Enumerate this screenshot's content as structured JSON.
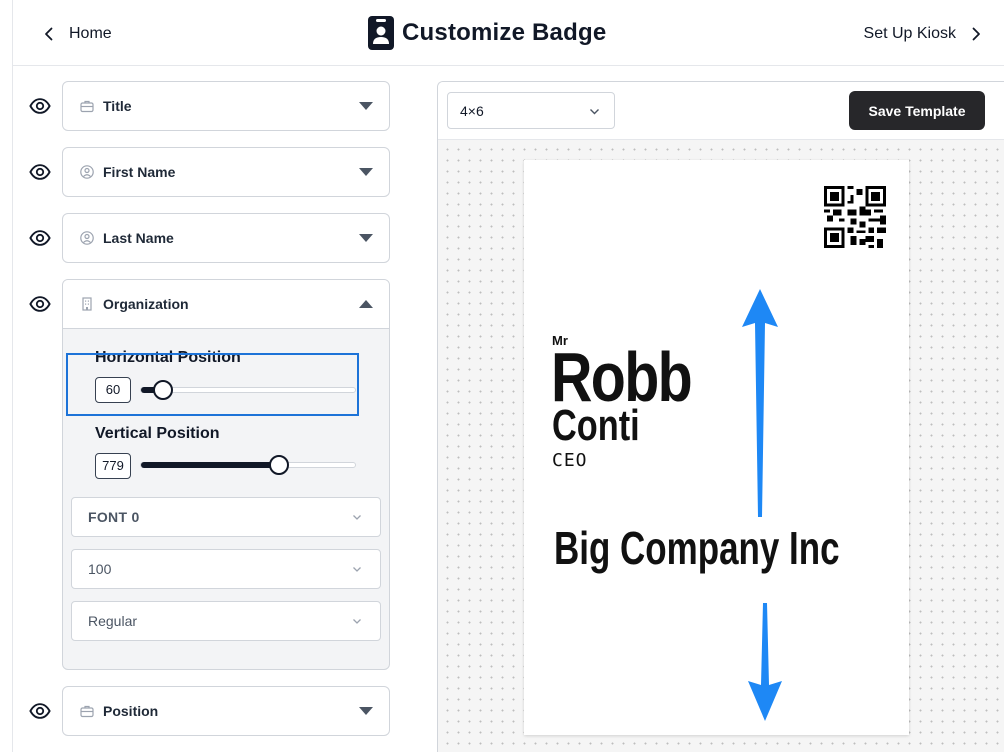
{
  "header": {
    "back_label": "Home",
    "title": "Customize Badge",
    "next_label": "Set Up Kiosk"
  },
  "fields": [
    {
      "label": "Title",
      "icon": "briefcase-icon"
    },
    {
      "label": "First Name",
      "icon": "user-circle-icon"
    },
    {
      "label": "Last Name",
      "icon": "user-circle-icon"
    },
    {
      "label": "Organization",
      "icon": "building-icon"
    },
    {
      "label": "Position",
      "icon": "briefcase-icon"
    }
  ],
  "organization_settings": {
    "horizontal_label": "Horizontal Position",
    "horizontal_value": "60",
    "vertical_label": "Vertical Position",
    "vertical_value": "779",
    "font_family": "FONT 0",
    "font_size": "100",
    "font_weight": "Regular"
  },
  "toolbar": {
    "size_value": "4×6",
    "save_label": "Save Template"
  },
  "badge": {
    "title": "Mr",
    "first_name": "Robb",
    "last_name": "Conti",
    "position": "CEO",
    "organization": "Big Company Inc"
  },
  "colors": {
    "accent": "#1d73d8",
    "arrow": "#1e88f5",
    "button": "#27272a"
  }
}
